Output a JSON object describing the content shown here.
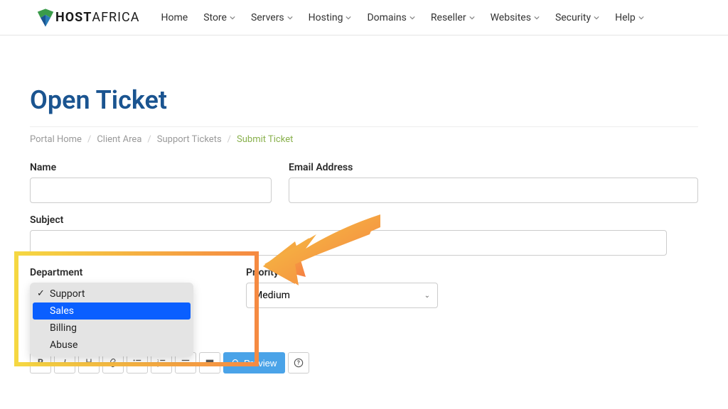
{
  "nav": {
    "logo_text_a": "HOST",
    "logo_text_b": "AFRICA",
    "items": [
      {
        "label": "Home",
        "dropdown": false
      },
      {
        "label": "Store",
        "dropdown": true
      },
      {
        "label": "Servers",
        "dropdown": true
      },
      {
        "label": "Hosting",
        "dropdown": true
      },
      {
        "label": "Domains",
        "dropdown": true
      },
      {
        "label": "Reseller",
        "dropdown": true
      },
      {
        "label": "Websites",
        "dropdown": true
      },
      {
        "label": "Security",
        "dropdown": true
      },
      {
        "label": "Help",
        "dropdown": true
      }
    ]
  },
  "page_title": "Open Ticket",
  "breadcrumb": {
    "items": [
      "Portal Home",
      "Client Area",
      "Support Tickets"
    ],
    "current": "Submit Ticket"
  },
  "form": {
    "name_label": "Name",
    "email_label": "Email Address",
    "subject_label": "Subject",
    "department_label": "Department",
    "priority_label": "Priority",
    "priority_value": "Medium",
    "department_options": [
      {
        "label": "Support",
        "checked": true,
        "selected": false
      },
      {
        "label": "Sales",
        "checked": false,
        "selected": true
      },
      {
        "label": "Billing",
        "checked": false,
        "selected": false
      },
      {
        "label": "Abuse",
        "checked": false,
        "selected": false
      }
    ]
  },
  "toolbar": {
    "preview_label": "Preview"
  }
}
